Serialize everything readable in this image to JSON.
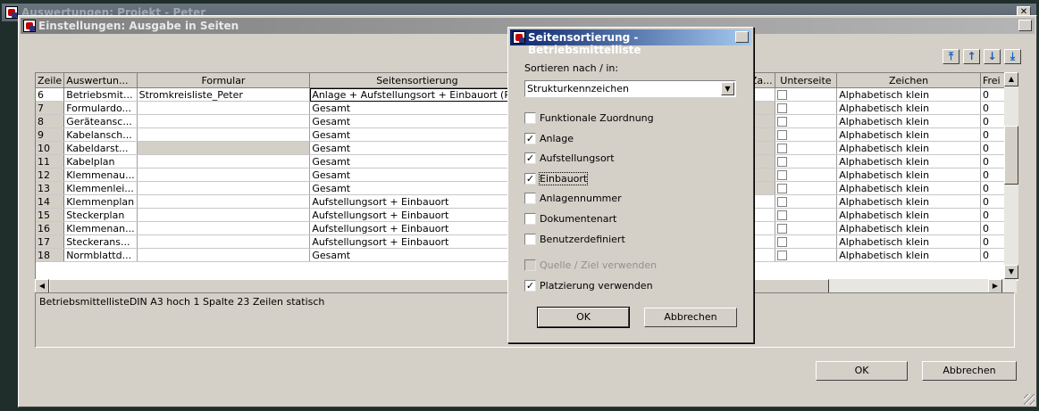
{
  "background_window": {
    "title": "Auswertungen: Projekt - Peter"
  },
  "main_dialog": {
    "title": "Einstellungen: Ausgabe in Seiten",
    "columns": [
      "Zeile",
      "Auswertun...",
      "Formular",
      "Seitensortierung",
      "Za...",
      "Unterseite",
      "Zeichen",
      "Frei"
    ],
    "rows": [
      {
        "zeile": "6",
        "auswertung": "Betriebsmit...",
        "formular": "Stromkreisliste_Peter",
        "sort": "Anlage + Aufstellungsort + Einbauort (Pl...",
        "zeichen": "Alphabetisch klein",
        "frei": "0"
      },
      {
        "zeile": "7",
        "auswertung": "Formulardo...",
        "formular": "",
        "sort": "Gesamt",
        "zeichen": "Alphabetisch klein",
        "frei": "0"
      },
      {
        "zeile": "8",
        "auswertung": "Geräteansc...",
        "formular": "",
        "sort": "Gesamt",
        "zeichen": "Alphabetisch klein",
        "frei": "0"
      },
      {
        "zeile": "9",
        "auswertung": "Kabelansch...",
        "formular": "",
        "sort": "Gesamt",
        "zeichen": "Alphabetisch klein",
        "frei": "0"
      },
      {
        "zeile": "10",
        "auswertung": "Kabeldarst...",
        "formular": "",
        "sort": "Gesamt",
        "zeichen": "Alphabetisch klein",
        "frei": "0"
      },
      {
        "zeile": "11",
        "auswertung": "Kabelplan",
        "formular": "",
        "sort": "Gesamt",
        "zeichen": "Alphabetisch klein",
        "frei": "0"
      },
      {
        "zeile": "12",
        "auswertung": "Klemmenau...",
        "formular": "",
        "sort": "Gesamt",
        "zeichen": "Alphabetisch klein",
        "frei": "0"
      },
      {
        "zeile": "13",
        "auswertung": "Klemmenlei...",
        "formular": "",
        "sort": "Gesamt",
        "zeichen": "Alphabetisch klein",
        "frei": "0"
      },
      {
        "zeile": "14",
        "auswertung": "Klemmenplan",
        "formular": "",
        "sort": "Aufstellungsort + Einbauort",
        "zeichen": "Alphabetisch klein",
        "frei": "0"
      },
      {
        "zeile": "15",
        "auswertung": "Steckerplan",
        "formular": "",
        "sort": "Aufstellungsort + Einbauort",
        "zeichen": "Alphabetisch klein",
        "frei": "0"
      },
      {
        "zeile": "16",
        "auswertung": "Klemmenan...",
        "formular": "",
        "sort": "Aufstellungsort + Einbauort",
        "zeichen": "Alphabetisch klein",
        "frei": "0"
      },
      {
        "zeile": "17",
        "auswertung": "Steckerans...",
        "formular": "",
        "sort": "Aufstellungsort + Einbauort",
        "zeichen": "Alphabetisch klein",
        "frei": "0"
      },
      {
        "zeile": "18",
        "auswertung": "Normblattd...",
        "formular": "",
        "sort": "Gesamt",
        "zeichen": "Alphabetisch klein",
        "frei": "0"
      }
    ],
    "info_text": "BetriebsmittellisteDIN A3 hoch 1 Spalte 23 Zeilen statisch",
    "ok_label": "OK",
    "cancel_label": "Abbrechen"
  },
  "sort_dialog": {
    "title": "Seitensortierung - Betriebsmittelliste",
    "sort_label": "Sortieren nach / in:",
    "sort_value": "Strukturkennzeichen",
    "options": [
      {
        "label": "Funktionale Zuordnung",
        "checked": false
      },
      {
        "label": "Anlage",
        "checked": true
      },
      {
        "label": "Aufstellungsort",
        "checked": true
      },
      {
        "label": "Einbauort",
        "checked": true
      },
      {
        "label": "Anlagennummer",
        "checked": false
      },
      {
        "label": "Dokumentenart",
        "checked": false
      },
      {
        "label": "Benutzerdefiniert",
        "checked": false
      }
    ],
    "source_target_label": "Quelle / Ziel verwenden",
    "placement_label": "Platzierung verwenden",
    "ok_label": "OK",
    "cancel_label": "Abbrechen"
  }
}
